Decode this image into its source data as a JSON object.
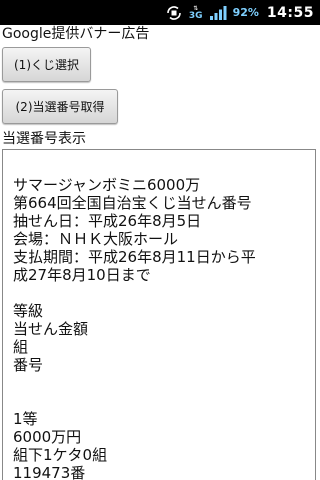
{
  "status_bar": {
    "network_label": "3G",
    "battery_text": "92%",
    "time": "14:55",
    "icons": [
      "rotation-lock-icon",
      "data-3g-icon",
      "signal-strength-icon",
      "battery-icon"
    ]
  },
  "app": {
    "banner_text": "Google提供バナー広告",
    "buttons": {
      "select_lottery": "(1)くじ選択",
      "fetch_numbers": "(2)当選番号取得"
    },
    "display_label": "当選番号表示",
    "result_lines": [
      "",
      "サマージャンボミニ6000万",
      "第664回全国自治宝くじ当せん番号",
      "抽せん日：平成26年8月5日",
      "会場：ＮＨＫ大阪ホール",
      "支払期間：平成26年8月11日から平",
      "成27年8月10日まで",
      "",
      "等級",
      "当せん金額",
      "組",
      "番号",
      "",
      "",
      "1等",
      "6000万円",
      "組下1ケタ0組",
      "119473番"
    ]
  }
}
